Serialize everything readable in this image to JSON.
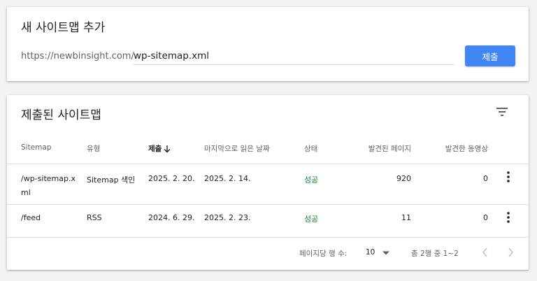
{
  "add_card": {
    "title": "새 사이트맵 추가",
    "url_prefix": "https://newbinsight.com/",
    "input_value": "wp-sitemap.xml",
    "submit_label": "제출"
  },
  "list_card": {
    "title": "제출된 사이트맵",
    "columns": {
      "sitemap": "Sitemap",
      "type": "유형",
      "submitted": "제출",
      "last_read": "마지막으로 읽은 날짜",
      "status": "상태",
      "pages": "발견된 페이지",
      "videos": "발견한 동영상"
    },
    "rows": [
      {
        "sitemap_line1": "/wp-sitemap.x",
        "sitemap_line2": "ml",
        "type": "Sitemap 색인",
        "submitted": "2025. 2. 20.",
        "last_read": "2025. 2. 14.",
        "status": "성공",
        "pages": "920",
        "videos": "0"
      },
      {
        "sitemap": "/feed",
        "type": "RSS",
        "submitted": "2024. 6. 29.",
        "last_read": "2025. 2. 23.",
        "status": "성공",
        "pages": "11",
        "videos": "0"
      }
    ],
    "footer": {
      "rows_per_page_label": "페이지당 행 수:",
      "rows_per_page_value": "10",
      "range_text": "총 2행 중 1~2"
    }
  },
  "colors": {
    "primary": "#4285f4",
    "success": "#188038",
    "background": "#f1f3f4"
  },
  "icons": [
    "filter-icon",
    "sort-arrow-down-icon",
    "more-vert-icon",
    "dropdown-arrow-icon",
    "chevron-left-icon",
    "chevron-right-icon"
  ]
}
